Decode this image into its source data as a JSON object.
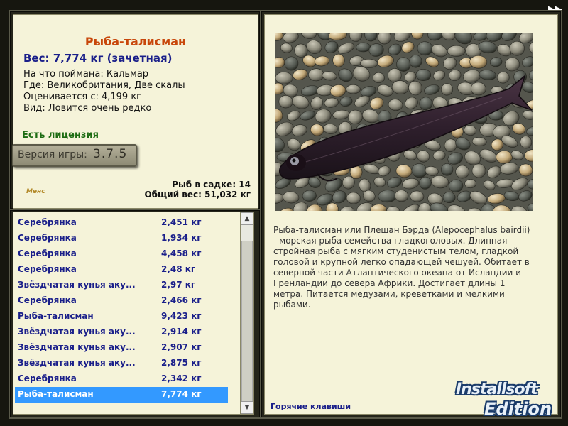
{
  "info": {
    "title": "Рыба-талисман",
    "weight": "Вес: 7,774 кг (зачетная)",
    "lines": [
      "На что поймана: Кальмар",
      "Где: Великобритания, Две скалы",
      "Оценивается с: 4,199 кг",
      "Вид: Ловится очень редко"
    ],
    "license": "Есть лицензия",
    "version_label": "Версия игры:",
    "version_num": "3.7.5",
    "logo_text": "Менс",
    "keep_count": "Рыб в садке: 14",
    "total_weight": "Общий вес: 51,032 кг"
  },
  "catch_list": [
    {
      "name": "Серебрянка",
      "weight": "2,451 кг",
      "selected": false
    },
    {
      "name": "Серебрянка",
      "weight": "1,934 кг",
      "selected": false
    },
    {
      "name": "Серебрянка",
      "weight": "4,458 кг",
      "selected": false
    },
    {
      "name": "Серебрянка",
      "weight": "2,48 кг",
      "selected": false
    },
    {
      "name": "Звёздчатая кунья аку...",
      "weight": "2,97 кг",
      "selected": false
    },
    {
      "name": "Серебрянка",
      "weight": "2,466 кг",
      "selected": false
    },
    {
      "name": "Рыба-талисман",
      "weight": "9,423 кг",
      "selected": false
    },
    {
      "name": "Звёздчатая кунья аку...",
      "weight": "2,914 кг",
      "selected": false
    },
    {
      "name": "Звёздчатая кунья аку...",
      "weight": "2,907 кг",
      "selected": false
    },
    {
      "name": "Звёздчатая кунья аку...",
      "weight": "2,875 кг",
      "selected": false
    },
    {
      "name": "Серебрянка",
      "weight": "2,342 кг",
      "selected": false
    },
    {
      "name": "Рыба-талисман",
      "weight": "7,774 кг",
      "selected": true
    }
  ],
  "description": "Рыба-талисман или Плешан Бэрда (Alepocephalus bairdii) - морская рыба семейства гладкоголовых. Длинная стройная рыба с мягким студенистым телом, гладкой головой и крупной легко опадающей чешуей. Обитает в северной части Атлантического океана от Исландии и Гренландии до севера Африки. Достигает длины 1 метра. Питается медузами, креветками и мелкими рыбами.",
  "hotkeys": "Горячие клавиши",
  "watermark": {
    "line1": "Installsoft",
    "line2": "Edition"
  },
  "icons": {
    "next": "double-arrow-right-icon",
    "scroll_up": "chevron-up-icon",
    "scroll_down": "chevron-down-icon"
  },
  "colors": {
    "title": "#c8470b",
    "fish_blue": "#1a1f8a",
    "license_green": "#1c6b12",
    "selection": "#3399ff"
  }
}
